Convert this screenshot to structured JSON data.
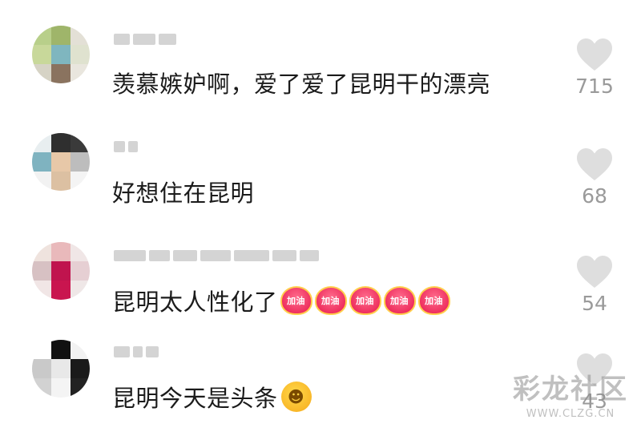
{
  "comments": [
    {
      "text": "羡慕嫉妒啊，爱了爱了昆明干的漂亮",
      "likes": "715",
      "avatar_colors": [
        "#b8cf8a",
        "#9fb56a",
        "#e3e0d6",
        "#c8d89a",
        "#7fb6bf",
        "#dfe2cf",
        "#d6d3c5",
        "#8a735f",
        "#e9e6de"
      ],
      "stickers": [],
      "emoji": null
    },
    {
      "text": "好想住在昆明",
      "likes": "68",
      "avatar_colors": [
        "#e8eef0",
        "#2f2f2f",
        "#3a3a3a",
        "#7fb3c0",
        "#e7c8a8",
        "#bdbdbd",
        "#f2f2f2",
        "#dcc0a2",
        "#f4f4f4"
      ],
      "stickers": [],
      "emoji": null
    },
    {
      "text": "昆明太人性化了",
      "likes": "54",
      "avatar_colors": [
        "#efe3de",
        "#e9b9bb",
        "#f0e6e6",
        "#d7c1c3",
        "#c0144e",
        "#e6cfd3",
        "#f1e6e6",
        "#c9154f",
        "#efe7e7"
      ],
      "stickers": [
        "加油",
        "加油",
        "加油",
        "加油",
        "加油"
      ],
      "emoji": null
    },
    {
      "text": "昆明今天是头条",
      "likes": "43",
      "avatar_colors": [
        "#ffffff",
        "#111111",
        "#f2f2f2",
        "#c9c9c9",
        "#e8e8e8",
        "#1a1a1a",
        "#d2d2d2",
        "#f4f4f4",
        "#222222"
      ],
      "stickers": [],
      "emoji": "laugh-crying"
    }
  ],
  "watermark": {
    "main": "彩龙社区",
    "url": "WWW.CLZG.CN"
  },
  "colors": {
    "like_heart": "#dedede",
    "like_count": "#9a9a9a",
    "text": "#1b1b1b"
  }
}
